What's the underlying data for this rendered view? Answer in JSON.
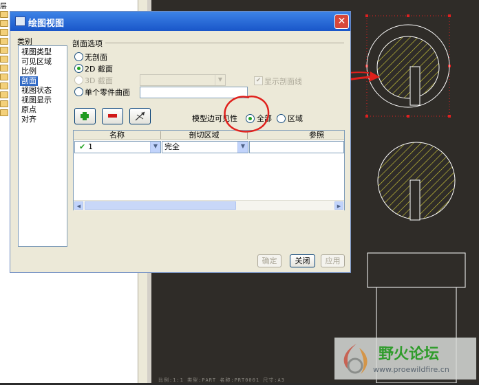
{
  "tree": {
    "top_char": "层"
  },
  "dialog": {
    "title": "绘图视图",
    "close_glyph": "✕",
    "category_label": "类别",
    "categories": [
      {
        "label": "视图类型",
        "selected": false
      },
      {
        "label": "可见区域",
        "selected": false
      },
      {
        "label": "比例",
        "selected": false
      },
      {
        "label": "剖面",
        "selected": true
      },
      {
        "label": "视图状态",
        "selected": false
      },
      {
        "label": "视图显示",
        "selected": false
      },
      {
        "label": "原点",
        "selected": false
      },
      {
        "label": "对齐",
        "selected": false
      }
    ],
    "section_options_label": "剖面选项",
    "radio_none": "无剖面",
    "radio_2d": "2D  截面",
    "radio_3d": "3D  截面",
    "radio_single_surface": "单个零件曲面",
    "show_section_line_label": "显示剖面线",
    "show_section_line_checked": true,
    "add_icon": "plus-icon",
    "remove_icon": "minus-icon",
    "flip_icon": "flip-icon",
    "model_edge_visibility_label": "模型边可见性",
    "radio_all": "全部",
    "radio_region": "区域",
    "table": {
      "headers": [
        "名称",
        "剖切区域",
        "参照"
      ],
      "rows": [
        {
          "check": "✔",
          "name": "1",
          "region": "完全",
          "ref": ""
        }
      ]
    },
    "buttons": {
      "ok": "确定",
      "close": "关闭",
      "apply": "应用"
    }
  },
  "canvas": {
    "status_text": "比例:1:1    类型:PART  名称:PRT0001  尺寸:A3"
  },
  "watermark": {
    "text": "野火论坛",
    "url": "www.proewildfire.cn"
  },
  "colors": {
    "title_bar": "#1956c9",
    "selection": "#316ac5",
    "hatch": "#d8d23a",
    "annotation_red": "#e0201c",
    "selection_handles": "#e02020"
  }
}
